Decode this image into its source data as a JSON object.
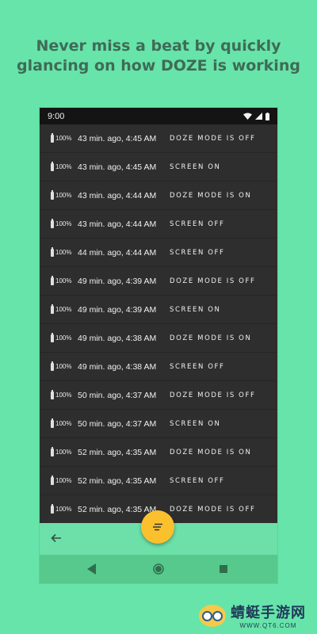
{
  "headline": "Never miss a beat by quickly\nglancing on how DOZE is working",
  "phone": {
    "status_time": "9:00",
    "log": [
      {
        "battery": "100%",
        "time": "43 min. ago, 4:45 AM",
        "event": "DOZE MODE IS OFF"
      },
      {
        "battery": "100%",
        "time": "43 min. ago, 4:45 AM",
        "event": "SCREEN ON"
      },
      {
        "battery": "100%",
        "time": "43 min. ago, 4:44 AM",
        "event": "DOZE MODE IS ON"
      },
      {
        "battery": "100%",
        "time": "43 min. ago, 4:44 AM",
        "event": "SCREEN OFF"
      },
      {
        "battery": "100%",
        "time": "44 min. ago, 4:44 AM",
        "event": "SCREEN OFF"
      },
      {
        "battery": "100%",
        "time": "49 min. ago, 4:39 AM",
        "event": "DOZE MODE IS OFF"
      },
      {
        "battery": "100%",
        "time": "49 min. ago, 4:39 AM",
        "event": "SCREEN ON"
      },
      {
        "battery": "100%",
        "time": "49 min. ago, 4:38 AM",
        "event": "DOZE MODE IS ON"
      },
      {
        "battery": "100%",
        "time": "49 min. ago, 4:38 AM",
        "event": "SCREEN OFF"
      },
      {
        "battery": "100%",
        "time": "50 min. ago, 4:37 AM",
        "event": "DOZE MODE IS OFF"
      },
      {
        "battery": "100%",
        "time": "50 min. ago, 4:37 AM",
        "event": "SCREEN ON"
      },
      {
        "battery": "100%",
        "time": "52 min. ago, 4:35 AM",
        "event": "DOZE MODE IS ON"
      },
      {
        "battery": "100%",
        "time": "52 min. ago, 4:35 AM",
        "event": "SCREEN OFF"
      },
      {
        "battery": "100%",
        "time": "52 min. ago, 4:35 AM",
        "event": "DOZE MODE IS OFF"
      }
    ],
    "icons": {
      "back": "arrow-back-icon",
      "fab": "sort-lines-icon",
      "wifi": "wifi-icon",
      "signal": "signal-icon",
      "battery": "battery-icon"
    }
  },
  "watermark": {
    "title": "蜻蜓手游网",
    "url": "WWW.QT6.COM"
  },
  "colors": {
    "background": "#67e4a9",
    "headline": "#3f6b57",
    "list_bg": "#2e2e2e",
    "fab": "#fbc02d",
    "nav_bar": "#57c98d"
  }
}
